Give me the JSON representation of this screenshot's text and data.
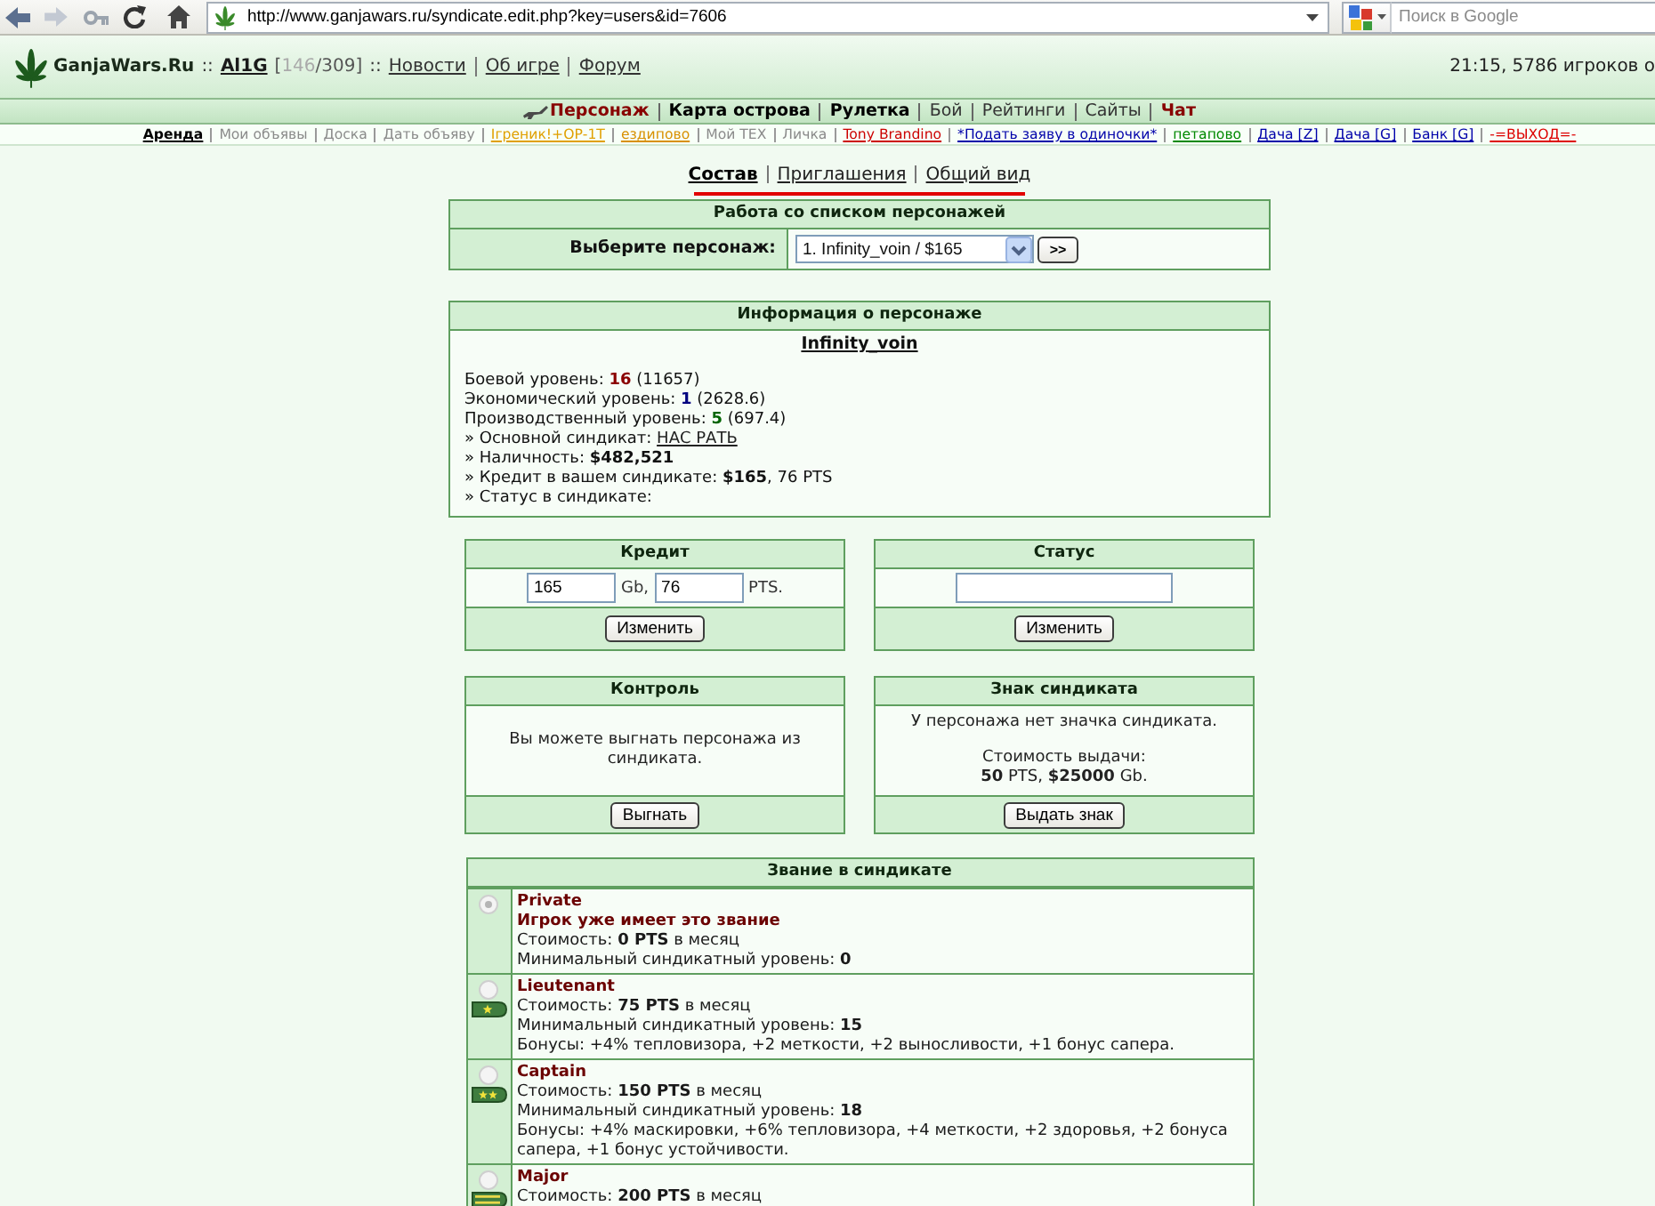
{
  "browser": {
    "address": "http://www.ganjawars.ru/syndicate.edit.php?key=users&id=7606",
    "search_placeholder": "Поиск в Google"
  },
  "header": {
    "segments": [
      {
        "kind": "brand",
        "text": "GanjaWars.Ru"
      },
      {
        "kind": "sep",
        "text": "::"
      },
      {
        "kind": "user",
        "text": "Al1G"
      },
      {
        "kind": "health",
        "prefix": "[",
        "current": "146",
        "suffix": "/309]"
      },
      {
        "kind": "sep",
        "text": "::"
      },
      {
        "kind": "link",
        "text": "Новости"
      },
      {
        "kind": "link",
        "text": "Об игре"
      },
      {
        "kind": "link",
        "text": "Форум"
      }
    ],
    "status": "21:15, 5786 игроков о"
  },
  "main_nav": [
    {
      "label": "Персонаж",
      "kind": "current",
      "color": "#880000"
    },
    {
      "label": "Карта острова",
      "kind": "major",
      "color": "#000000"
    },
    {
      "label": "Рулетка",
      "kind": "major",
      "color": "#000000"
    },
    {
      "label": "Бой",
      "kind": "minor",
      "color": "#333333"
    },
    {
      "label": "Рейтинги",
      "kind": "minor",
      "color": "#333333"
    },
    {
      "label": "Сайты",
      "kind": "minor",
      "color": "#333333"
    },
    {
      "label": "Чат",
      "kind": "major",
      "color": "#880000"
    }
  ],
  "sub_nav": [
    {
      "label": "Аренда",
      "kind": "current",
      "color": "#000000"
    },
    {
      "label": "Мои объявы",
      "kind": "plain",
      "color": "#8a8a8a"
    },
    {
      "label": "Доска",
      "kind": "plain",
      "color": "#8a8a8a"
    },
    {
      "label": "Дать объяву",
      "kind": "plain",
      "color": "#8a8a8a"
    },
    {
      "label": "Ігреник!+ОР-1Т",
      "kind": "link",
      "color": "#e0a000"
    },
    {
      "label": "ездипово",
      "kind": "link",
      "color": "#d89000"
    },
    {
      "label": "Мой ТЕХ",
      "kind": "plain",
      "color": "#8a8a8a"
    },
    {
      "label": "Личка",
      "kind": "plain",
      "color": "#8a8a8a"
    },
    {
      "label": "Tony Brandino",
      "kind": "link",
      "color": "#cc0000"
    },
    {
      "label": "*Подать заяву в одиночки*",
      "kind": "link",
      "color": "#0000aa"
    },
    {
      "label": "петапово",
      "kind": "link",
      "color": "#008800"
    },
    {
      "label": "Дача [Z]",
      "kind": "link",
      "color": "#0000aa"
    },
    {
      "label": "Дача [G]",
      "kind": "link",
      "color": "#0000aa"
    },
    {
      "label": "Банк [G]",
      "kind": "link",
      "color": "#0000aa"
    },
    {
      "label": "-=ВЫХОД=-",
      "kind": "link",
      "color": "#dd0000"
    }
  ],
  "tabs": [
    {
      "label": "Состав",
      "selected": true
    },
    {
      "label": "Приглашения",
      "selected": false
    },
    {
      "label": "Общий вид",
      "selected": false
    }
  ],
  "character_list": {
    "title": "Работа со списком персонажей",
    "label": "Выберите персонаж:",
    "value": "1. Infinity_voin / $165",
    "button": ">>"
  },
  "character_info": {
    "title": "Информация о персонаже",
    "name": "Infinity_voin",
    "levels": [
      {
        "label": "Боевой уровень:",
        "value": "16",
        "detail": "(11657)",
        "color": "#8b0000"
      },
      {
        "label": "Экономический уровень:",
        "value": "1",
        "detail": "(2628.6)",
        "color": "#00007f"
      },
      {
        "label": "Производственный уровень:",
        "value": "5",
        "detail": "(697.4)",
        "color": "#006400"
      }
    ],
    "facts": [
      {
        "kind": "link",
        "label": "» Основной синдикат:",
        "link": "НАС РАТЬ"
      },
      {
        "kind": "text",
        "text": "» Наличность: **$482,521**"
      },
      {
        "kind": "text",
        "text": "» Кредит в вашем синдикате: **$165**, 76 PTS"
      },
      {
        "kind": "text",
        "text": "» Статус в синдикате:"
      }
    ]
  },
  "credit": {
    "title": "Кредит",
    "money": "165",
    "money_unit": "Gb,",
    "points": "76",
    "points_unit": "PTS.",
    "button": "Изменить"
  },
  "status": {
    "title": "Статус",
    "button": "Изменить"
  },
  "control": {
    "title": "Контроль",
    "text": "Вы можете выгнать персонажа из синдиката.",
    "button": "Выгнать"
  },
  "badge": {
    "title": "Знак синдиката",
    "text": "У персонажа нет значка синдиката.",
    "cost_label": "Стоимость выдачи:",
    "cost": "**50** PTS, **$25000** Gb.",
    "button": "Выдать знак"
  },
  "ranks": {
    "title": "Звание в синдикате",
    "items": [
      {
        "name": "Private",
        "note": "Игрок уже имеет это звание",
        "cost": "Стоимость: **0 PTS** в месяц",
        "min_level": "Минимальный синдикатный уровень: **0**",
        "kind": "plain",
        "selected": true,
        "disabled": true
      },
      {
        "name": "Lieutenant",
        "cost": "Стоимость: **75 PTS** в месяц",
        "min_level": "Минимальный синдикатный уровень: **15**",
        "bonus": "Бонусы: +4% тепловизора, +2 меткости, +2 выносливости, +1 бонус сапера.",
        "kind": "onestar",
        "selected": false,
        "disabled": true
      },
      {
        "name": "Captain",
        "cost": "Стоимость: **150 PTS** в месяц",
        "min_level": "Минимальный синдикатный уровень: **18**",
        "bonus": "Бонусы: +4% маскировки, +6% тепловизора, +4 меткости, +2 здоровья, +2 бонуса сапера, +1 бонус устойчивости.",
        "kind": "twostar",
        "selected": false,
        "disabled": true
      },
      {
        "name": "Major",
        "cost": "Стоимость: **200 PTS** в месяц",
        "kind": "bars",
        "selected": false,
        "disabled": true
      }
    ]
  }
}
